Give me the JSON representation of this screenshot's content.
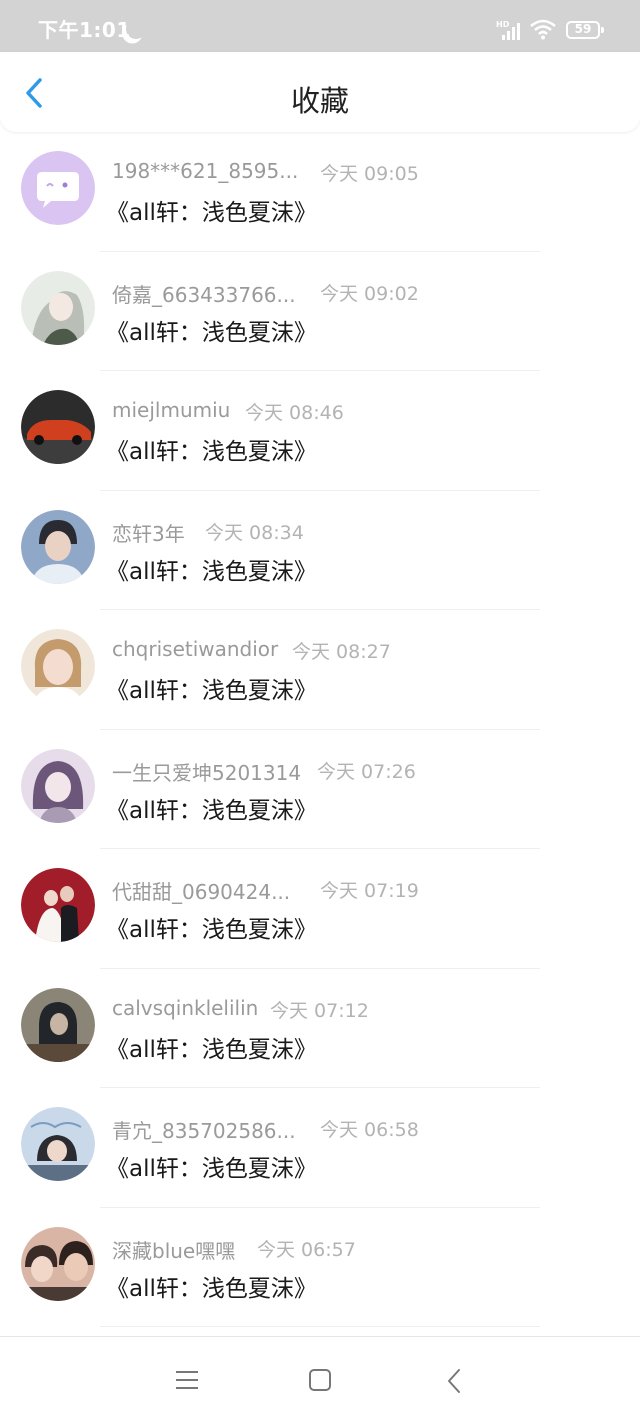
{
  "status_bar": {
    "time": "下午1:01",
    "network": "HD",
    "battery": "59"
  },
  "header": {
    "title": "收藏"
  },
  "items": [
    {
      "username": "198***621_8595...",
      "time": "今天 09:05",
      "title": "《all轩：浅色夏沫》",
      "avatar": "default-chat-avatar",
      "avatar_color": "#d9c4f2"
    },
    {
      "username": "倚嘉_663433766...",
      "time": "今天 09:02",
      "title": "《all轩：浅色夏沫》",
      "avatar": "anime-girl-avatar",
      "avatar_color": "#c7cdc5"
    },
    {
      "username": "miejlmumiu",
      "time": "今天 08:46",
      "title": "《all轩：浅色夏沫》",
      "avatar": "red-car-avatar",
      "avatar_color": "#2c2c2c"
    },
    {
      "username": "恋轩3年",
      "time": "今天 08:34",
      "title": "《all轩：浅色夏沫》",
      "avatar": "boy-photo-avatar",
      "avatar_color": "#8fa8c8"
    },
    {
      "username": "chqrisetiwandior",
      "time": "今天 08:27",
      "title": "《all轩：浅色夏沫》",
      "avatar": "girl-photo-avatar",
      "avatar_color": "#e2c6ae"
    },
    {
      "username": "一生只爱坤5201314",
      "time": "今天 07:26",
      "title": "《all轩：浅色夏沫》",
      "avatar": "anime-purple-avatar",
      "avatar_color": "#b7a3c6"
    },
    {
      "username": "代甜甜_0690424...",
      "time": "今天 07:19",
      "title": "《all轩：浅色夏沫》",
      "avatar": "wedding-photo-avatar",
      "avatar_color": "#a11d2a"
    },
    {
      "username": "calvsqinklelilin",
      "time": "今天 07:12",
      "title": "《all轩：浅色夏沫》",
      "avatar": "dark-hoodie-avatar",
      "avatar_color": "#5a574f"
    },
    {
      "username": "青宂_835702586...",
      "time": "今天 06:58",
      "title": "《all轩：浅色夏沫》",
      "avatar": "sky-girl-avatar",
      "avatar_color": "#a9c2dd"
    },
    {
      "username": "深藏blue嘿嘿",
      "time": "今天 06:57",
      "title": "《all轩：浅色夏沫》",
      "avatar": "couple-photo-avatar",
      "avatar_color": "#b9877a"
    }
  ],
  "colors": {
    "accent": "#2f9be8",
    "status_bar": "#d3d3d3"
  }
}
